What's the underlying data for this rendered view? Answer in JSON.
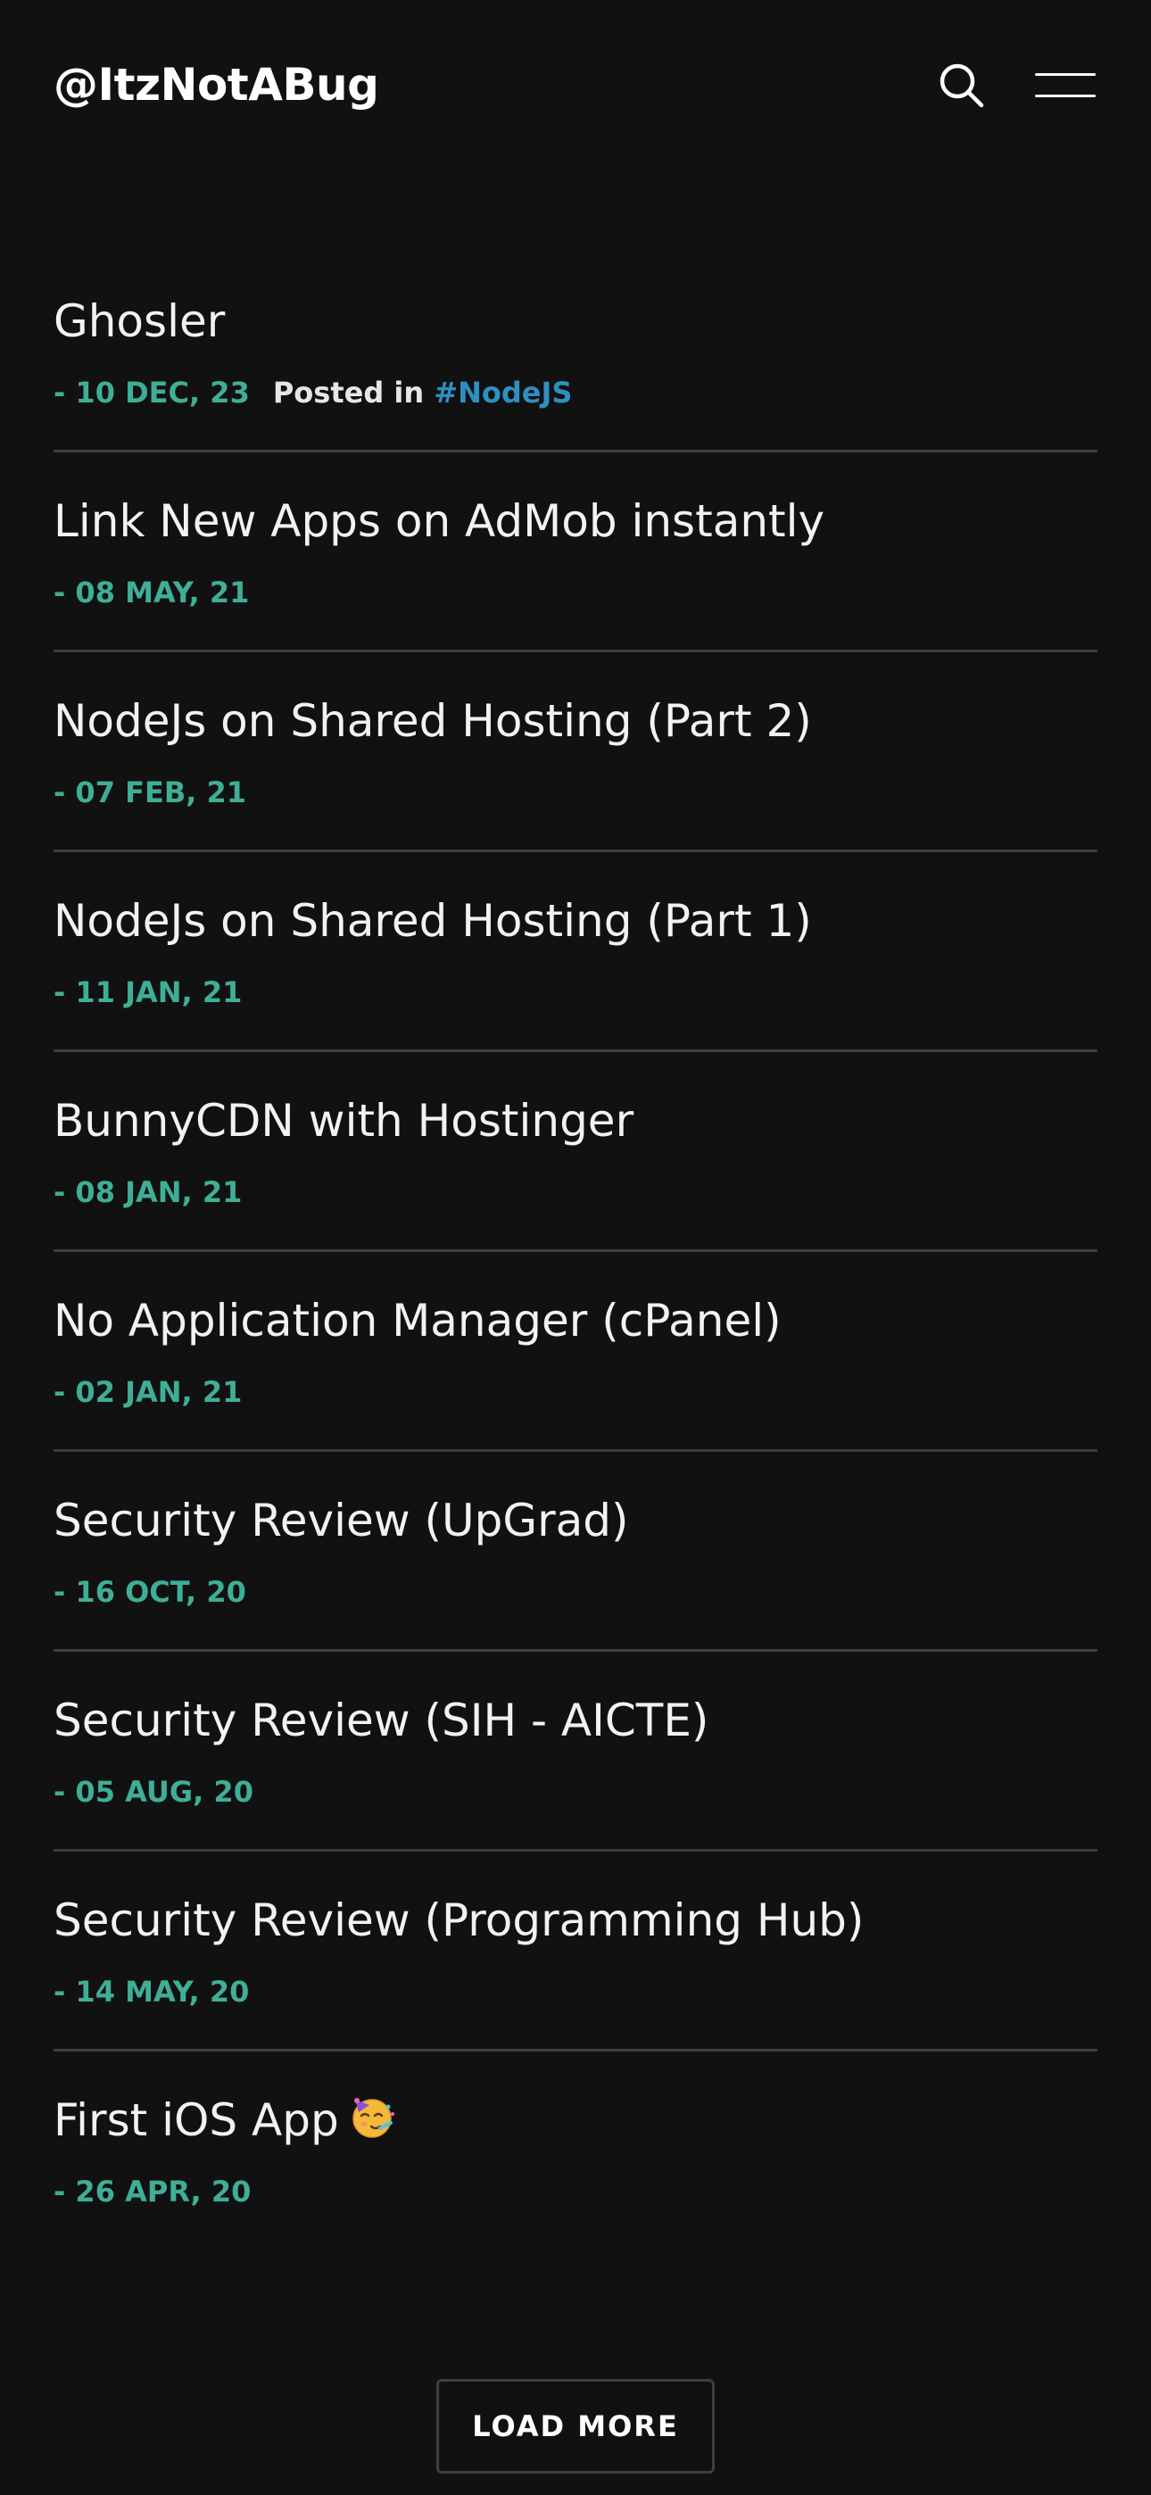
{
  "header": {
    "site_title": "@ItzNotABug",
    "search_icon": "search-icon",
    "menu_icon": "hamburger-menu-icon"
  },
  "colors": {
    "background": "#111112",
    "date_accent": "#3fae96",
    "tag_accent": "#2f8fc0",
    "divider": "#3e3e40"
  },
  "posts": [
    {
      "title": "Ghosler",
      "date": "- 10 DEC, 23",
      "posted_in_label": "Posted in",
      "tag": "#NodeJS"
    },
    {
      "title": "Link New Apps on AdMob instantly",
      "date": "- 08 MAY, 21"
    },
    {
      "title": "NodeJs on Shared Hosting (Part 2)",
      "date": "- 07 FEB, 21"
    },
    {
      "title": "NodeJs on Shared Hosting (Part 1)",
      "date": "- 11 JAN, 21"
    },
    {
      "title": "BunnyCDN with Hostinger",
      "date": "- 08 JAN, 21"
    },
    {
      "title": "No Application Manager (cPanel)",
      "date": "- 02 JAN, 21"
    },
    {
      "title": "Security Review (UpGrad)",
      "date": "- 16 OCT, 20"
    },
    {
      "title": "Security Review (SIH - AICTE)",
      "date": "- 05 AUG, 20"
    },
    {
      "title": "Security Review (Programming Hub)",
      "date": "- 14 MAY, 20"
    },
    {
      "title": "First iOS App",
      "date": "- 26 APR, 20",
      "emoji_icon": "partying-face-emoji-icon"
    }
  ],
  "load_more_label": "LOAD MORE"
}
